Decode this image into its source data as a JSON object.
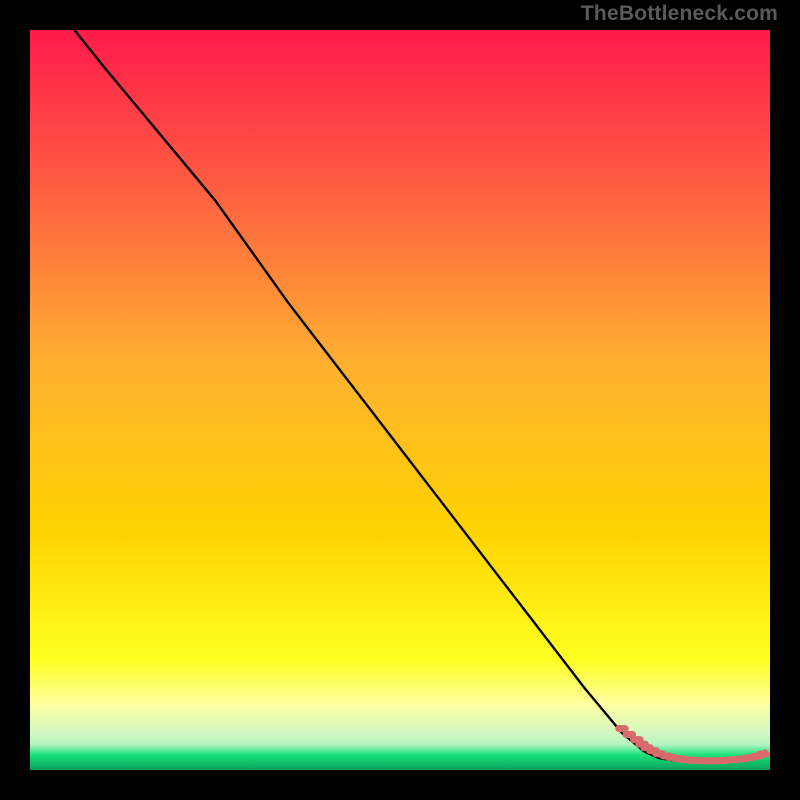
{
  "attribution": "TheBottleneck.com",
  "colors": {
    "gradient_top": "#ff1a4a",
    "gradient_mid_upper": "#ff7a3a",
    "gradient_mid": "#ffd400",
    "gradient_yellow_pale": "#ffff9e",
    "gradient_green_pale": "#b8f5c2",
    "gradient_green": "#16e27a",
    "gradient_green_dark": "#0aa05a",
    "line": "#000000",
    "marker": "#d76b6b"
  },
  "chart_data": {
    "type": "line",
    "title": "",
    "xlabel": "",
    "ylabel": "",
    "xlim": [
      0,
      100
    ],
    "ylim": [
      0,
      100
    ],
    "series": [
      {
        "name": "curve",
        "x": [
          6,
          10,
          15,
          20,
          25,
          30,
          35,
          40,
          45,
          50,
          55,
          60,
          65,
          70,
          75,
          80,
          83,
          85,
          87,
          89,
          91,
          93,
          95,
          97,
          99
        ],
        "y": [
          100,
          95,
          89,
          83,
          77,
          70,
          63,
          56.5,
          50,
          43.5,
          37,
          30.5,
          24,
          17.5,
          11,
          5,
          2.5,
          1.6,
          1.3,
          1.2,
          1.15,
          1.2,
          1.35,
          1.6,
          2.1
        ]
      }
    ],
    "markers": {
      "name": "points",
      "x": [
        80,
        81,
        82,
        82.7,
        83.4,
        84.2,
        85,
        86,
        86.7,
        87.5,
        88.2,
        89,
        90,
        91.2,
        92.2,
        93,
        94,
        95.2,
        96.3,
        97.2,
        98.2,
        99
      ],
      "y": [
        5.6,
        4.8,
        4.1,
        3.5,
        3.0,
        2.6,
        2.2,
        1.9,
        1.7,
        1.55,
        1.45,
        1.35,
        1.3,
        1.25,
        1.23,
        1.25,
        1.3,
        1.4,
        1.5,
        1.65,
        1.85,
        2.15
      ]
    }
  }
}
